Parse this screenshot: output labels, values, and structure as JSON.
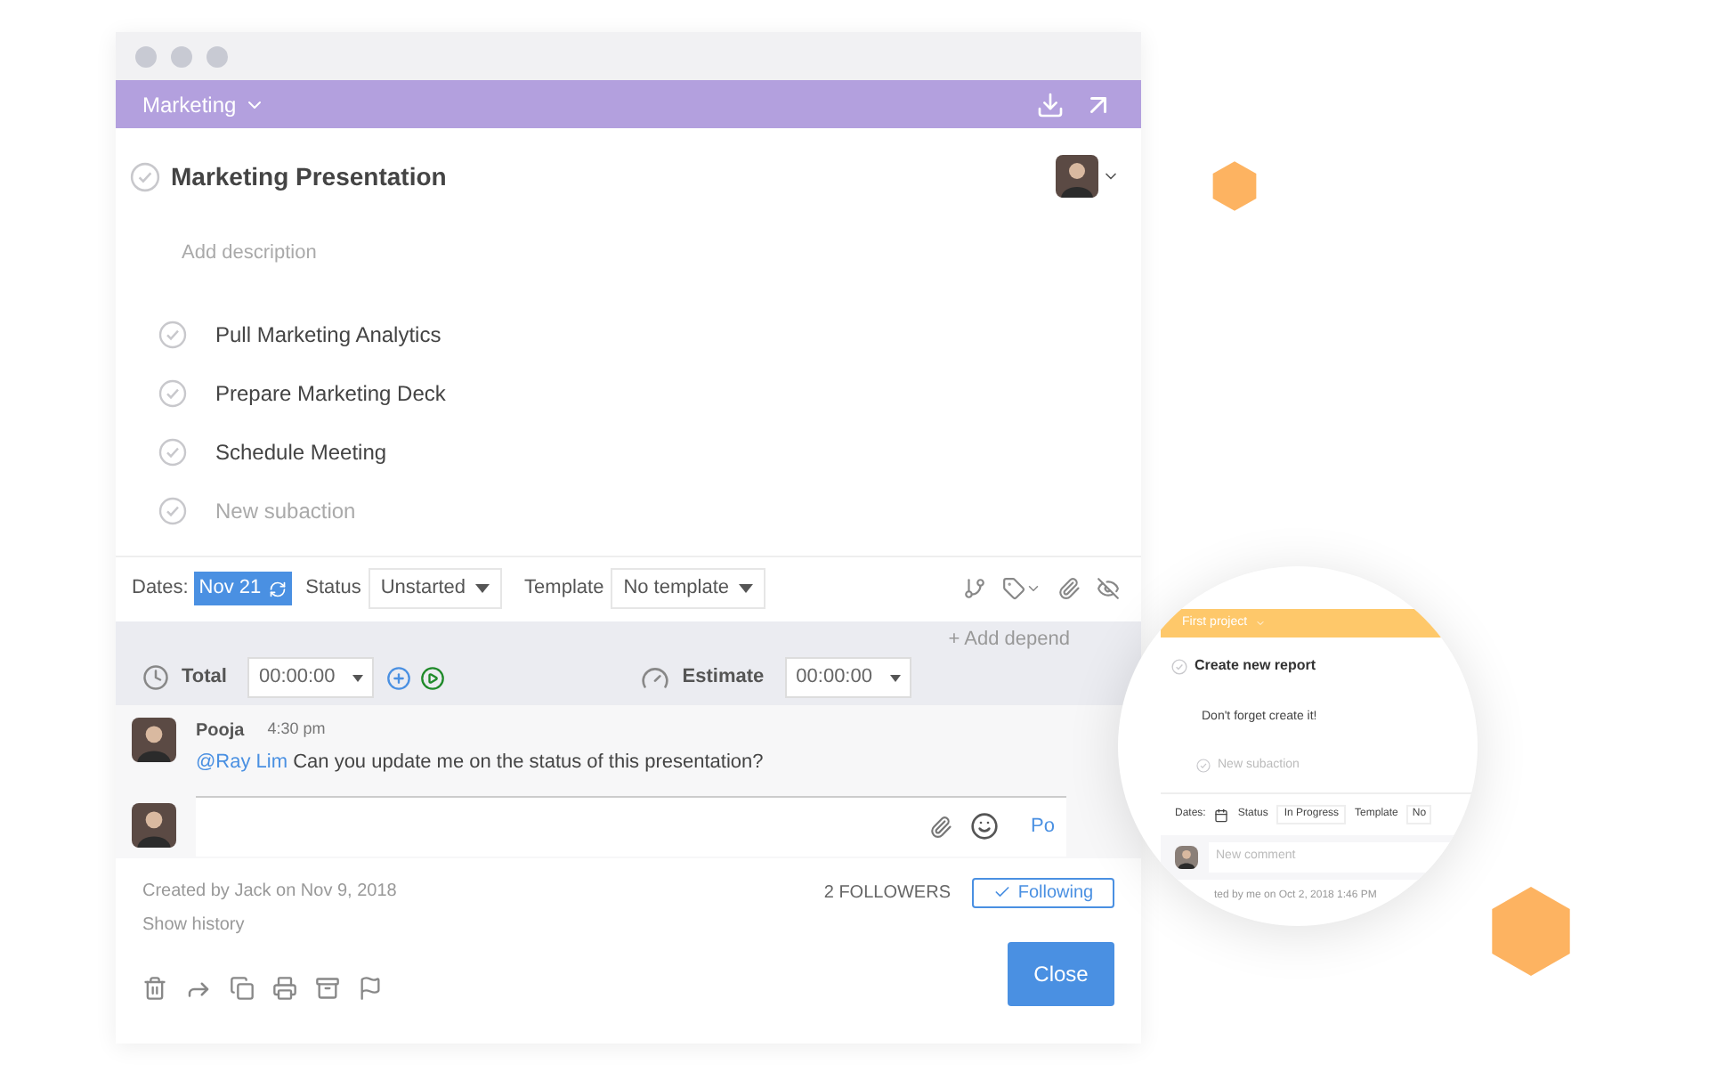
{
  "header": {
    "project": "Marketing"
  },
  "task": {
    "title": "Marketing Presentation"
  },
  "description": {
    "placeholder": "Add description"
  },
  "subactions": [
    {
      "label": "Pull Marketing Analytics"
    },
    {
      "label": "Prepare Marketing Deck"
    },
    {
      "label": "Schedule Meeting"
    }
  ],
  "new_subaction": {
    "placeholder": "New subaction"
  },
  "details": {
    "dates_label": "Dates:",
    "date": "Nov 21",
    "status_label": "Status",
    "status": "Unstarted",
    "template_label": "Template",
    "template": "No template"
  },
  "add_dependency": "+ Add depend",
  "time": {
    "total_label": "Total",
    "total": "00:00:00",
    "estimate_label": "Estimate",
    "estimate": "00:00:00"
  },
  "comment": {
    "author": "Pooja",
    "time": "4:30 pm",
    "mention": "@Ray Lim",
    "text": "Can you update me on the status of this presentation?"
  },
  "post_button": "Po",
  "footer": {
    "created": "Created by Jack on Nov 9, 2018",
    "history": "Show history",
    "followers": "2 FOLLOWERS",
    "following": "Following",
    "close": "Close"
  },
  "inset": {
    "project": "First project",
    "title": "Create new report",
    "description": "Don't forget create it!",
    "new_subaction": "New subaction",
    "dates_label": "Dates:",
    "status_label": "Status",
    "status": "In Progress",
    "template_label": "Template",
    "template": "No",
    "comment_placeholder": "New comment",
    "created": "ted by me on Oct 2, 2018 1:46 PM"
  }
}
